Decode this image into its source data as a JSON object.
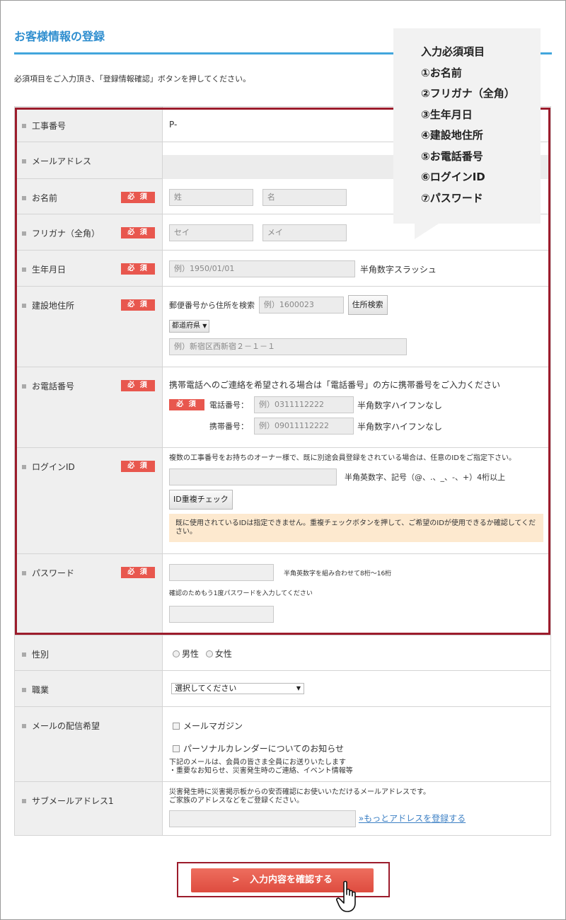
{
  "header": {
    "title": "お客様情報の登録",
    "instruction": "必須項目をご入力頂き、「登録情報確認」ボタンを押してください。"
  },
  "required_badge": "必 須",
  "callout": {
    "title": "入力必須項目",
    "items": [
      "①お名前",
      "②フリガナ（全角）",
      "③生年月日",
      "④建設地住所",
      "⑤お電話番号",
      "⑥ログインID",
      "⑦パスワード"
    ]
  },
  "rows": {
    "construction_no": {
      "label": "工事番号",
      "value": "P-"
    },
    "email": {
      "label": "メールアドレス"
    },
    "name": {
      "label": "お名前",
      "last_placeholder": "姓",
      "first_placeholder": "名"
    },
    "furigana": {
      "label": "フリガナ（全角）",
      "last_placeholder": "セイ",
      "first_placeholder": "メイ"
    },
    "birthdate": {
      "label": "生年月日",
      "placeholder": "例）1950/01/01",
      "note": "半角数字スラッシュ"
    },
    "address": {
      "label": "建設地住所",
      "zip_label": "郵便番号から住所を検索",
      "zip_placeholder": "例）1600023",
      "search_button": "住所検索",
      "prefecture_select": "都道府県",
      "address_placeholder": "例）新宿区西新宿２－１－１"
    },
    "phone": {
      "label": "お電話番号",
      "instruction": "携帯電話へのご連絡を希望される場合は「電話番号」の方に携帯番号をご入力ください",
      "tel_label": "電話番号：",
      "tel_placeholder": "例）0311112222",
      "tel_note": "半角数字ハイフンなし",
      "mobile_label": "携帯番号：",
      "mobile_placeholder": "例）09011112222",
      "mobile_note": "半角数字ハイフンなし"
    },
    "login_id": {
      "label": "ログインID",
      "instruction": "複数の工事番号をお持ちのオーナー様で、既に別途会員登録をされている場合は、任意のIDをご指定下さい。",
      "note": "半角英数字、記号（@、.、_、-、+）4桁以上",
      "check_button": "ID重複チェック",
      "warning": "既に使用されているIDは指定できません。重複チェックボタンを押して、ご希望のIDが使用できるか確認してください。"
    },
    "password": {
      "label": "パスワード",
      "note": "半角英数字を組み合わせて8桁～16桁",
      "confirm_label": "確認のためもう1度パスワードを入力してください"
    },
    "gender": {
      "label": "性別",
      "male": "男性",
      "female": "女性"
    },
    "occupation": {
      "label": "職業",
      "select_value": "選択してください"
    },
    "mail_pref": {
      "label": "メールの配信希望",
      "option1": "メールマガジン",
      "option2": "パーソナルカレンダーについてのお知らせ",
      "note1": "下記のメールは、会員の皆さま全員にお送りいたします",
      "note2": "・重要なお知らせ、災害発生時のご連絡、イベント情報等"
    },
    "sub_email": {
      "label": "サブメールアドレス1",
      "note1": "災害発生時に災害掲示板からの安否確認にお使いいただけるメールアドレスです。",
      "note2": "ご家族のアドレスなどをご登録ください。",
      "more_link": "»もっとアドレスを登録する"
    }
  },
  "submit": {
    "label": "入力内容を確認する",
    "chevron": ">"
  },
  "colors": {
    "accent": "#42a6dc",
    "required": "#e8574e",
    "highlight_box": "#9c1c2c",
    "submit": "#e05548",
    "warning_bg": "#fde9cf"
  }
}
